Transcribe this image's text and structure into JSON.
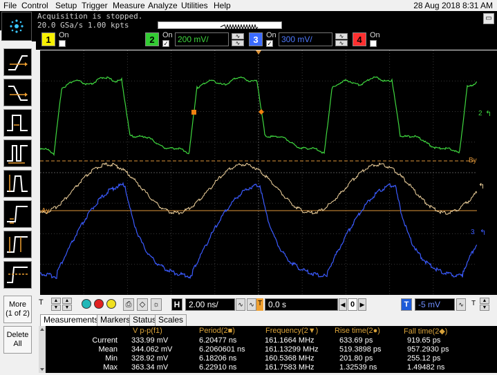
{
  "menu": [
    "File",
    "Control",
    "Setup",
    "Trigger",
    "Measure",
    "Analyze",
    "Utilities",
    "Help"
  ],
  "datetime": "28 Aug 2018  8:31 AM",
  "status": {
    "line1": "Acquisition is stopped.",
    "line2": "20.0 GSa/s    1.00 kpts"
  },
  "channels": [
    {
      "num": "1",
      "on": "On",
      "checked": "",
      "color": "#f7f000",
      "scale": ""
    },
    {
      "num": "2",
      "on": "On",
      "checked": "✓",
      "color": "#33cc33",
      "scale": "200 mV/"
    },
    {
      "num": "3",
      "on": "On",
      "checked": "✓",
      "color": "#3b6bff",
      "scale": "300 mV/"
    },
    {
      "num": "4",
      "on": "On",
      "checked": "",
      "color": "#ff3030",
      "scale": ""
    }
  ],
  "sidebar": {
    "more": "More",
    "more_sub": "(1 of 2)",
    "delete": "Delete",
    "delete_sub": "All"
  },
  "markers": {
    "by": "By",
    "ay": "Ay",
    "ch2": "2",
    "ch3": "3"
  },
  "controls": {
    "timebase": "2.00 ns/",
    "delay": "0.0 s",
    "delay_ch": "0",
    "trigger_level": "-5 mV",
    "trigger_label": "T"
  },
  "tabs": [
    "Measurements",
    "Markers",
    "Status",
    "Scales"
  ],
  "measurements": {
    "headers": [
      "V p-p(f1)",
      "Period(2■)",
      "Frequency(2▼)",
      "Rise time(2●)",
      "Fall time(2◆)"
    ],
    "rows": [
      {
        "label": "Current",
        "values": [
          "333.99 mV",
          "6.20477 ns",
          "161.1664 MHz",
          "633.69 ps",
          "919.65 ps"
        ]
      },
      {
        "label": "Mean",
        "values": [
          "344.062 mV",
          "6.2060601 ns",
          "161.13299 MHz",
          "519.3898 ps",
          "957.2930 ps"
        ]
      },
      {
        "label": "Min",
        "values": [
          "328.92 mV",
          "6.18206 ns",
          "160.5368 MHz",
          "201.80 ps",
          "255.12 ps"
        ]
      },
      {
        "label": "Max",
        "values": [
          "363.34 mV",
          "6.22910 ns",
          "161.7583 MHz",
          "1.32539 ns",
          "1.49482 ns"
        ]
      }
    ]
  },
  "colors": {
    "ch2": "#3fd83f",
    "ch3": "#3b5bff",
    "math": "#f4d6a0",
    "marker": "#e0963a"
  }
}
